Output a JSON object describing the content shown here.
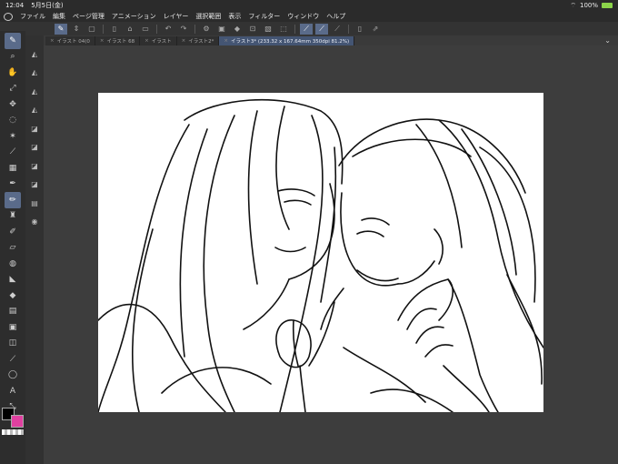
{
  "status": {
    "time": "12:04",
    "date": "5月5日(金)",
    "battery": "100%"
  },
  "menu": [
    "ファイル",
    "編集",
    "ページ管理",
    "アニメーション",
    "レイヤー",
    "選択範囲",
    "表示",
    "フィルター",
    "ウィンドウ",
    "ヘルプ"
  ],
  "tabs": [
    {
      "label": "イラスト 04(0",
      "active": false
    },
    {
      "label": "イラスト 68",
      "active": false
    },
    {
      "label": "イラスト",
      "active": false
    },
    {
      "label": "イラスト2*",
      "active": false
    },
    {
      "label": "イラスト3* (233.32 x 167.64mm 350dpi 81.2%)",
      "active": true
    }
  ],
  "colors": {
    "main": "#000000",
    "sub": "#e040a0"
  }
}
